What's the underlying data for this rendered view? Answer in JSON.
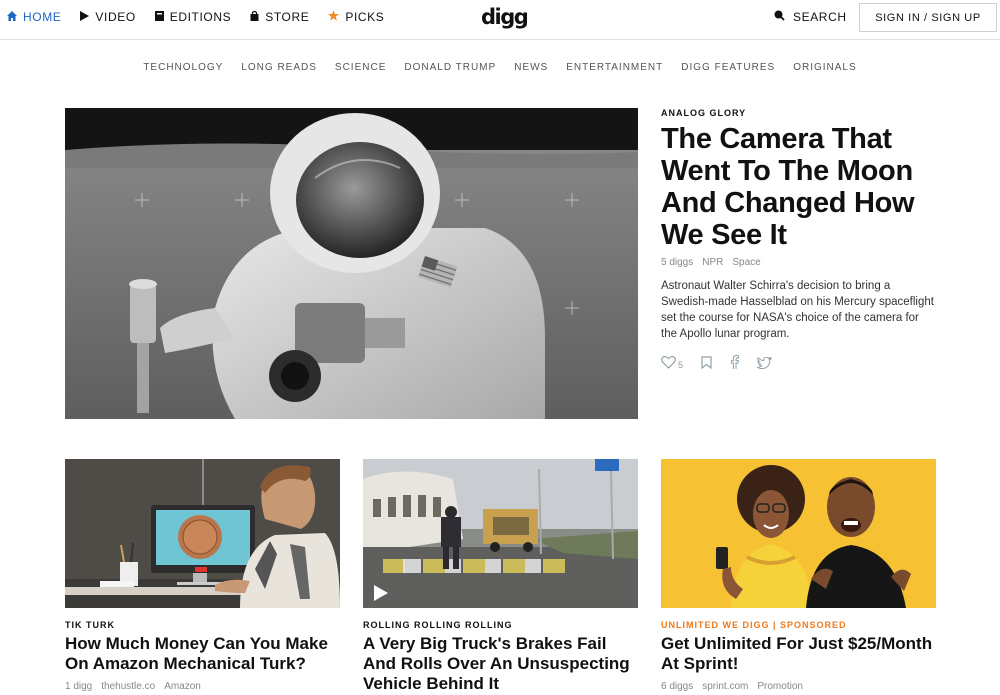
{
  "nav": {
    "items": [
      {
        "label": "HOME",
        "icon": "home-icon"
      },
      {
        "label": "VIDEO",
        "icon": "play-icon"
      },
      {
        "label": "EDITIONS",
        "icon": "editions-icon"
      },
      {
        "label": "STORE",
        "icon": "bag-icon"
      },
      {
        "label": "PICKS",
        "icon": "star-icon"
      }
    ],
    "logo": "digg",
    "search_label": "SEARCH",
    "signin_label": "SIGN IN / SIGN UP",
    "active_color": "#1a66c2",
    "star_color": "#f08a24"
  },
  "categories": [
    "TECHNOLOGY",
    "LONG READS",
    "SCIENCE",
    "DONALD TRUMP",
    "NEWS",
    "ENTERTAINMENT",
    "DIGG FEATURES",
    "ORIGINALS"
  ],
  "hero": {
    "kicker": "ANALOG GLORY",
    "title": "The Camera That Went To The Moon And Changed How We See It",
    "diggs": "5 diggs",
    "source": "NPR",
    "tag": "Space",
    "description": "Astronaut Walter Schirra's decision to bring a Swedish-made Hasselblad on his Mercury spaceflight set the course for NASA's choice of the camera for the Apollo lunar program.",
    "like_count": "5"
  },
  "cards": [
    {
      "kicker": "TIK TURK",
      "title": "How Much Money Can You Make On Amazon Mechanical Turk?",
      "diggs": "1 digg",
      "source": "thehustle.co",
      "tag": "Amazon"
    },
    {
      "kicker": "ROLLING ROLLING ROLLING",
      "title": "A Very Big Truck's Brakes Fail And Rolls Over An Unsuspecting Vehicle Behind It",
      "diggs": "",
      "source": "",
      "tag": ""
    },
    {
      "kicker": "UNLIMITED WE DIGG | SPONSORED",
      "title": "Get Unlimited For Just $25/Month At Sprint!",
      "diggs": "6 diggs",
      "source": "sprint.com",
      "tag": "Promotion",
      "kicker_color": "#f07a1a"
    }
  ]
}
